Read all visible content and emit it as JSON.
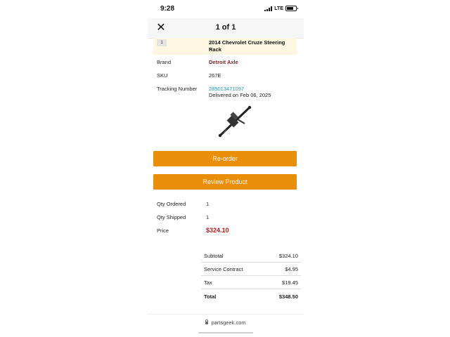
{
  "status_bar": {
    "time": "9:28",
    "network": "LTE"
  },
  "nav": {
    "pager": "1 of 1"
  },
  "item": {
    "qty_badge": "1",
    "title": "2014 Chevrolet Cruze Steering Rack",
    "brand_label": "Brand",
    "brand_value": "Detroit Axle",
    "sku_label": "SKU",
    "sku_value": "267E",
    "tracking_label": "Tracking Number",
    "tracking_number": "285013471097",
    "delivered": "Delivered on Feb 06, 2025"
  },
  "buttons": {
    "reorder": "Re-order",
    "review": "Review Product"
  },
  "quantities": {
    "ordered_label": "Qty Ordered",
    "ordered_value": "1",
    "shipped_label": "Qty Shipped",
    "shipped_value": "1",
    "price_label": "Price",
    "price_value": "$324.10"
  },
  "totals": [
    {
      "label": "Subtotal",
      "value": "$324.10"
    },
    {
      "label": "Service Contract",
      "value": "$4.95"
    },
    {
      "label": "Tax",
      "value": "$19.45"
    },
    {
      "label": "Total",
      "value": "$348.50"
    }
  ],
  "footer": {
    "url": "partsgeek.com"
  },
  "colors": {
    "accent": "#e98f0c",
    "brand": "#8b1a1a",
    "price": "#b51a1a",
    "link": "#2a8fb0",
    "item_header_bg": "#fdf7e1"
  },
  "icons": [
    "close-icon",
    "signal-icon",
    "battery-icon",
    "lock-icon",
    "steering-rack-image"
  ]
}
